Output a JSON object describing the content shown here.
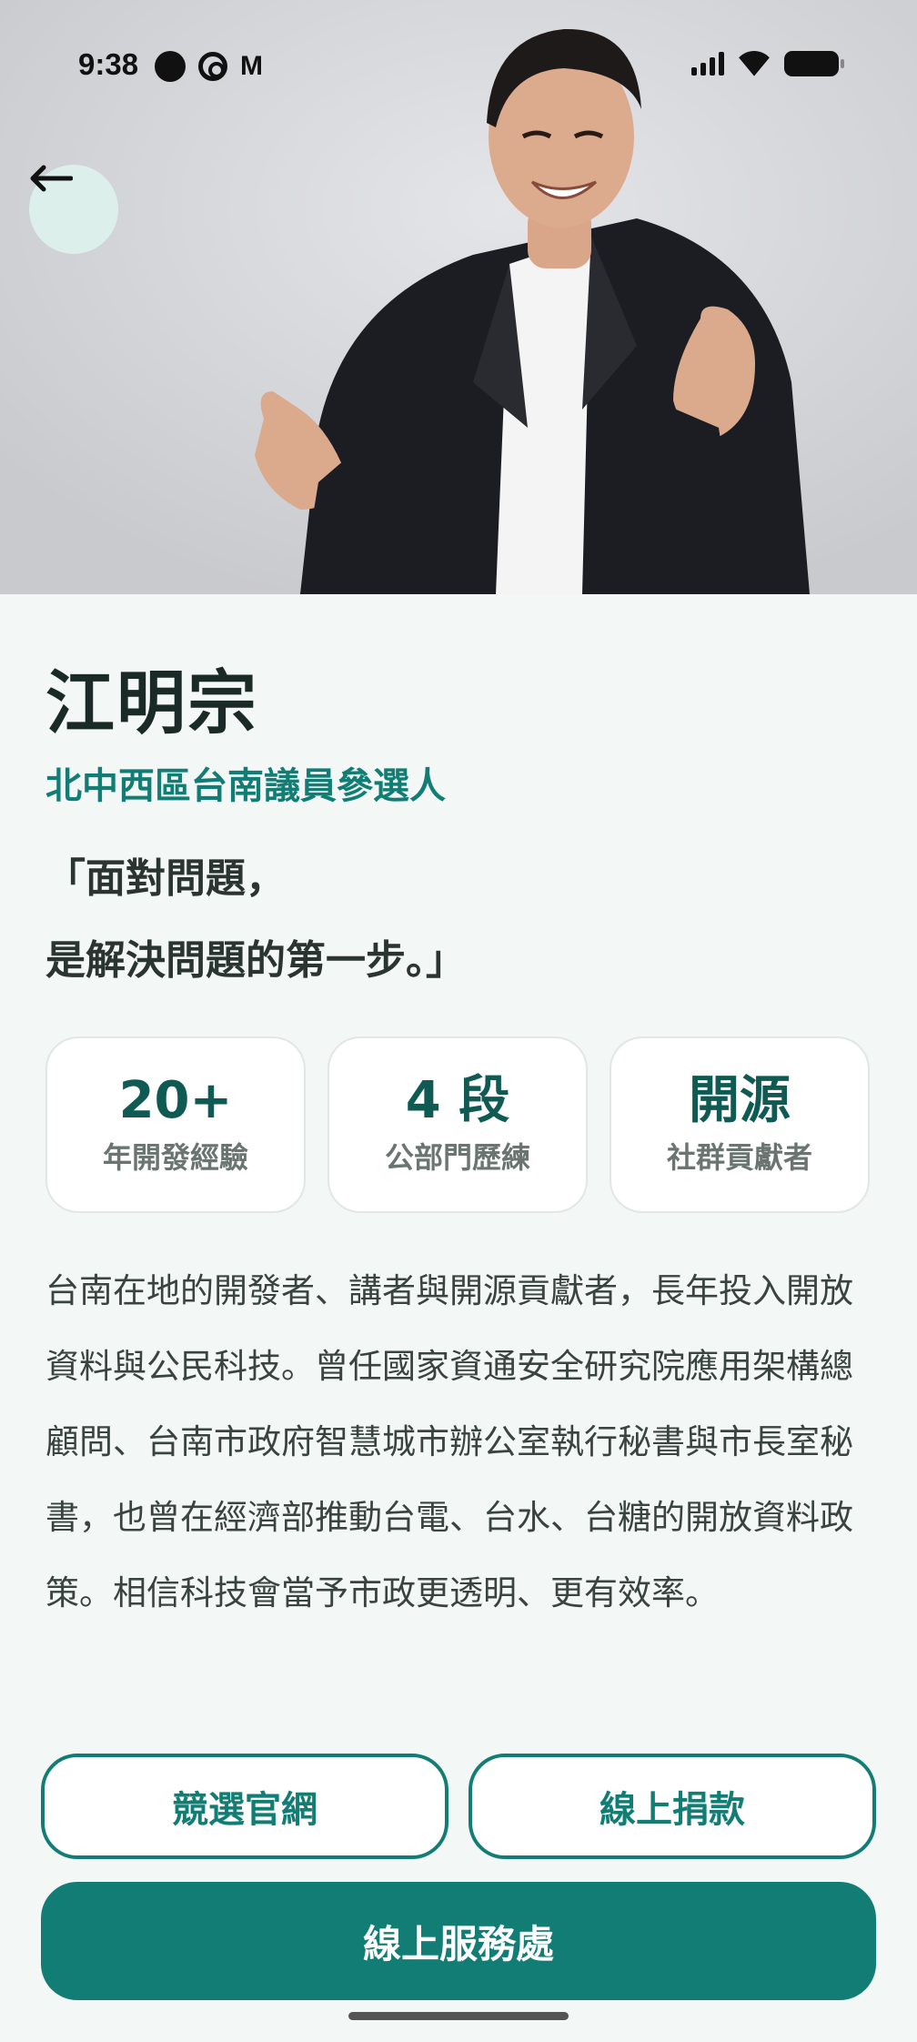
{
  "status_bar": {
    "time": "9:38",
    "left_icons": [
      "record-icon",
      "threads-icon",
      "gmail-icon"
    ],
    "mail_glyph": "M",
    "right_icons": [
      "signal-icon",
      "wifi-icon",
      "battery-icon"
    ]
  },
  "hero": {
    "image": "candidate-portrait",
    "back_icon": "arrow-left-icon"
  },
  "profile": {
    "name": "江明宗",
    "subtitle": "北中西區台南議員參選人",
    "quote_line1": "「面對問題，",
    "quote_line2": "是解決問題的第一步。」"
  },
  "stats": [
    {
      "value": "20+",
      "label": "年開發經驗"
    },
    {
      "value": "4 段",
      "label": "公部門歷練"
    },
    {
      "value": "開源",
      "label": "社群貢獻者"
    }
  ],
  "bio": "台南在地的開發者、講者與開源貢獻者，長年投入開放資料與公民科技。曾任國家資通安全研究院應用架構總顧問、台南市政府智慧城市辦公室執行秘書與市長室秘書，也曾在經濟部推動台電、台水、台糖的開放資料政策。相信科技會當予市政更透明、更有效率。",
  "actions": {
    "website_label": "競選官網",
    "donate_label": "線上捐款",
    "service_label": "線上服務處"
  },
  "colors": {
    "accent": "#127d74",
    "stat_value": "#0f5a52",
    "background": "#f3f7f6",
    "back_button_bg": "#dcefeb"
  }
}
